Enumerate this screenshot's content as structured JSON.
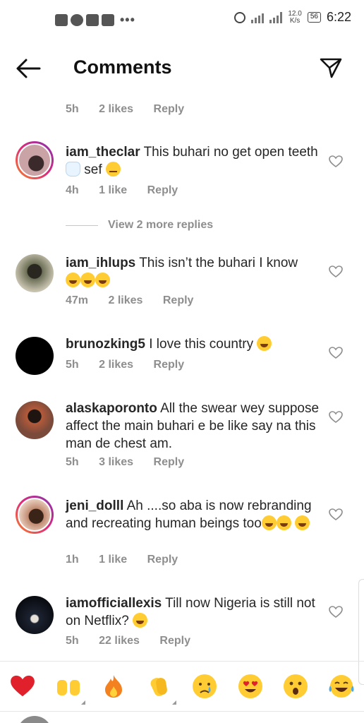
{
  "status_bar": {
    "time": "6:22",
    "network_speed_value": "12.0",
    "network_speed_unit": "K/s",
    "battery": "56",
    "network_type": "4G"
  },
  "header": {
    "title": "Comments",
    "back_icon": "arrow-left-icon",
    "send_icon": "paper-plane-icon"
  },
  "prev_comment_meta": {
    "time": "5h",
    "likes": "2 likes",
    "reply": "Reply"
  },
  "comments": [
    {
      "user": "iam_theclar",
      "text": "This buhari no get open teeth",
      "text_tail": "sef",
      "emojis": [
        "tooth-emoji",
        "face-with-rolling-eyes-emoji"
      ],
      "time": "4h",
      "likes": "1 like",
      "reply": "Reply",
      "avatar_colors": [
        "#c9a3a6",
        "#3a2a2c"
      ]
    },
    {
      "user": "iam_ihlups",
      "text": "This isn’t the buhari I know",
      "emojis": [
        "tears-of-joy-emoji",
        "tears-of-joy-emoji",
        "tears-of-joy-emoji"
      ],
      "time": "47m",
      "likes": "2 likes",
      "reply": "Reply",
      "avatar_colors": [
        "#6b6e55",
        "#2a2620"
      ]
    },
    {
      "user": "brunozking5",
      "text": "I love this country",
      "emojis": [
        "tears-of-joy-emoji"
      ],
      "time": "5h",
      "likes": "2 likes",
      "reply": "Reply",
      "avatar_colors": [
        "#000000",
        "#000000"
      ]
    },
    {
      "user": "alaskaporonto",
      "text": "All the swear wey suppose affect the main buhari e be like say na this man de chest am.",
      "emojis": [],
      "time": "5h",
      "likes": "3 likes",
      "reply": "Reply",
      "avatar_colors": [
        "#b45a3a",
        "#1e1410"
      ]
    },
    {
      "user": "jeni_dolll",
      "text": "Ah ....so aba is now rebranding and recreating human beings too",
      "emojis": [
        "tears-of-joy-emoji",
        "tears-of-joy-emoji",
        "tears-of-joy-emoji"
      ],
      "time": "1h",
      "likes": "1 like",
      "reply": "Reply",
      "avatar_colors": [
        "#c08a70",
        "#3a2418"
      ]
    },
    {
      "user": "iamofficiallexis",
      "text": "Till now Nigeria is still not on Netflix?",
      "emojis": [
        "tears-of-joy-emoji"
      ],
      "time": "5h",
      "likes": "22 likes",
      "reply": "Reply",
      "avatar_colors": [
        "#1c2331",
        "#0a0c12"
      ]
    }
  ],
  "view_more": "View 2 more replies",
  "reaction_bar": [
    "red-heart-emoji",
    "raising-hands-emoji",
    "fire-emoji",
    "clapping-hands-emoji",
    "crying-face-emoji",
    "heart-eyes-emoji",
    "astonished-face-emoji",
    "tears-of-joy-emoji"
  ]
}
